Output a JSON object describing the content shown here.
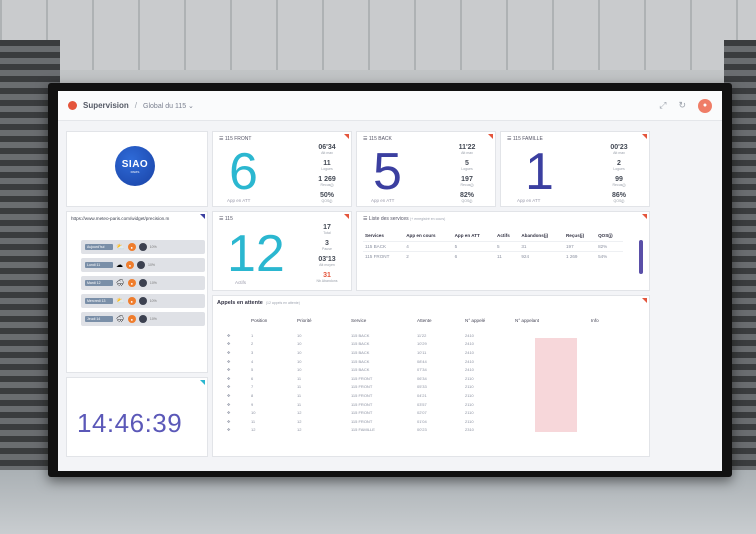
{
  "header": {
    "app_name": "Supervision",
    "separator": "/",
    "breadcrumb": "Global du 115 ⌄"
  },
  "siao": {
    "logo_text": "SIAO",
    "logo_sub": "PARIS"
  },
  "colors": {
    "front": "#2bb7d0",
    "back": "#3b3fa0",
    "famille": "#3b3fa0",
    "total": "#2bb7d0",
    "accent": "#e4553c"
  },
  "front": {
    "title": "115 FRONT",
    "big": "6",
    "big_label": "App en ATT",
    "stats": [
      {
        "v": "06'34",
        "l": "Att max"
      },
      {
        "v": "11",
        "l": "Logues"
      },
      {
        "v": "1 269",
        "l": "Recus(j)"
      },
      {
        "v": "50",
        "l": "QOS(j)"
      }
    ]
  },
  "back": {
    "title": "115 BACK",
    "big": "5",
    "big_label": "App en ATT",
    "stats": [
      {
        "v": "11'22",
        "l": "Att max"
      },
      {
        "v": "5",
        "l": "Logues"
      },
      {
        "v": "197",
        "l": "Recus(j)"
      },
      {
        "v": "82",
        "l": "QOS(j)"
      }
    ]
  },
  "famille": {
    "title": "115 FAMILLE",
    "big": "1",
    "big_label": "App en ATT",
    "stats": [
      {
        "v": "00'23",
        "l": "Att max"
      },
      {
        "v": "2",
        "l": "Logues"
      },
      {
        "v": "99",
        "l": "Recus(j)"
      },
      {
        "v": "86",
        "l": "QOS(j)"
      }
    ]
  },
  "total": {
    "title": "115",
    "big": "12",
    "big_label": "Actifs",
    "stats": [
      {
        "v": "17",
        "l": "Total"
      },
      {
        "v": "3",
        "l": "Pause"
      },
      {
        "v": "03'13",
        "l": "Att moyen"
      },
      {
        "v": "31",
        "l": "Nb Abandons"
      }
    ]
  },
  "meteo": {
    "url": "https://www.meteo-paris.com/widget/precision.m",
    "days": [
      "Aujourd'hui",
      "Lundi 11",
      "Mardi 12",
      "Mercredi 13",
      "Jeudi 14"
    ],
    "weather_glyphs": [
      "⛅",
      "☁",
      "🌧",
      "⛅",
      "🌧"
    ],
    "wind_glyphs": [
      "↑",
      "↑",
      "↑",
      "↑",
      "↑"
    ],
    "pcts": [
      "10%",
      "10%",
      "10%",
      "10%",
      "10%"
    ]
  },
  "clock": {
    "time": "14:46:39"
  },
  "services": {
    "title": "Liste des services",
    "subtitle": "(+ enregistré en cours)",
    "columns": [
      "Services",
      "App en cours",
      "App en ATT",
      "Actifs",
      "Abandons(j)",
      "Reçus(j)",
      "QOS(j)"
    ],
    "rows": [
      [
        "115 BACK",
        "4",
        "5",
        "5",
        "31",
        "197",
        "82%"
      ],
      [
        "115 FRONT",
        "2",
        "6",
        "11",
        "924",
        "1 269",
        "54%"
      ]
    ]
  },
  "calls": {
    "title": "Appels en attente",
    "subtitle": "(12 appels en attente)",
    "columns": [
      "Position",
      "Priorité",
      "Service",
      "Attente",
      "N° appelé",
      "N° appelant",
      "Info"
    ],
    "rows": [
      [
        "1",
        "10",
        "115 BACK",
        "11'22",
        "2410"
      ],
      [
        "2",
        "10",
        "115 BACK",
        "10'29",
        "2410"
      ],
      [
        "3",
        "10",
        "115 BACK",
        "10'11",
        "2410"
      ],
      [
        "4",
        "10",
        "115 BACK",
        "08'44",
        "2410"
      ],
      [
        "5",
        "10",
        "115 BACK",
        "07'34",
        "2410"
      ],
      [
        "6",
        "11",
        "115 FRONT",
        "06'34",
        "2110"
      ],
      [
        "7",
        "11",
        "115 FRONT",
        "05'33",
        "2110"
      ],
      [
        "8",
        "11",
        "115 FRONT",
        "04'21",
        "2110"
      ],
      [
        "9",
        "11",
        "115 FRONT",
        "03'57",
        "2110"
      ],
      [
        "10",
        "12",
        "115 FRONT",
        "02'07",
        "2110"
      ],
      [
        "11",
        "12",
        "115 FRONT",
        "01'04",
        "2110"
      ],
      [
        "12",
        "12",
        "115 FAMILLE",
        "00'23",
        "2310"
      ]
    ]
  }
}
